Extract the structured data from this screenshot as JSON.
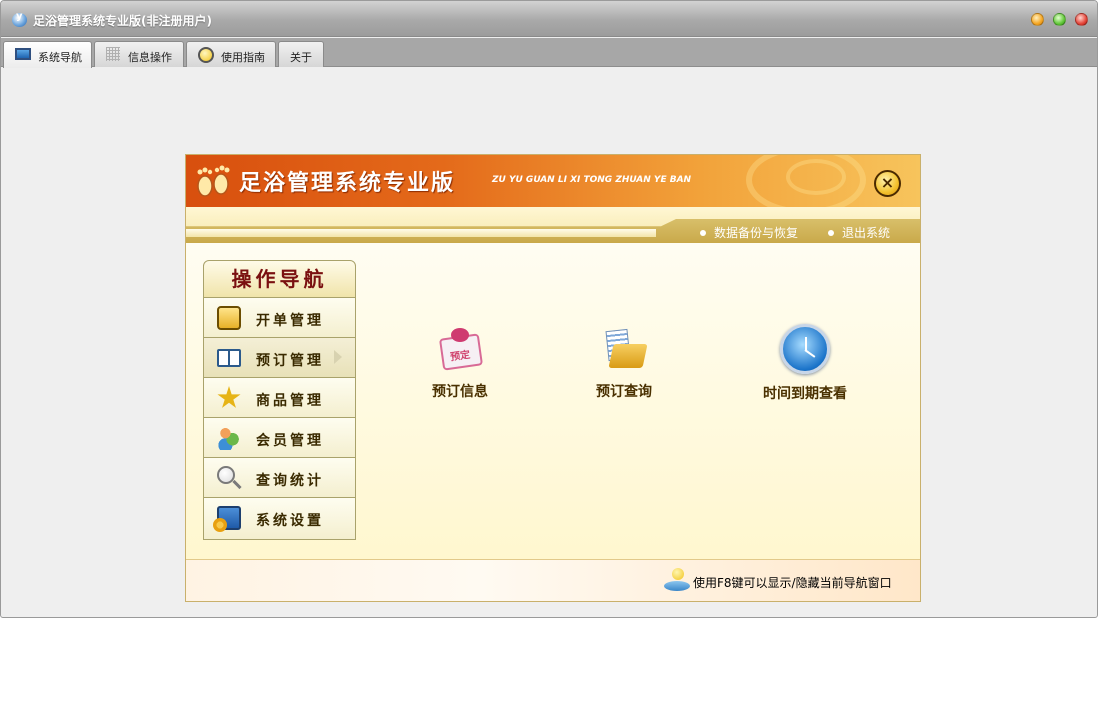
{
  "window": {
    "title": "足浴管理系统专业版(非注册用户)"
  },
  "tabs": [
    {
      "label": "系统导航",
      "icon": "monitor-icon",
      "active": true
    },
    {
      "label": "信息操作",
      "icon": "grid-icon",
      "active": false
    },
    {
      "label": "使用指南",
      "icon": "help-icon",
      "active": false
    },
    {
      "label": "关于",
      "icon": "",
      "active": false
    }
  ],
  "banner": {
    "title": "足浴管理系统专业版",
    "pinyin": "ZU YU GUAN LI XI TONG ZHUAN YE BAN",
    "links": [
      "数据备份与恢复",
      "退出系统"
    ]
  },
  "nav": {
    "heading": "操作导航",
    "items": [
      {
        "label": "开单管理",
        "icon": "note-icon"
      },
      {
        "label": "预订管理",
        "icon": "book-icon",
        "active": true
      },
      {
        "label": "商品管理",
        "icon": "star-icon"
      },
      {
        "label": "会员管理",
        "icon": "users-icon"
      },
      {
        "label": "查询统计",
        "icon": "magnifier-icon"
      },
      {
        "label": "系统设置",
        "icon": "settings-icon"
      }
    ]
  },
  "actions": [
    {
      "label": "预订信息",
      "icon": "booking-icon",
      "icon_text": "预定"
    },
    {
      "label": "预订查询",
      "icon": "folder-query-icon"
    },
    {
      "label": "时间到期查看",
      "icon": "clock-icon"
    }
  ],
  "footer": {
    "hint": "使用F8键可以显示/隐藏当前导航窗口"
  },
  "colors": {
    "banner_start": "#d84f0e",
    "banner_end": "#f7c45c",
    "nav_heading": "#7a1010",
    "panel_bg": "#fffbe6"
  }
}
